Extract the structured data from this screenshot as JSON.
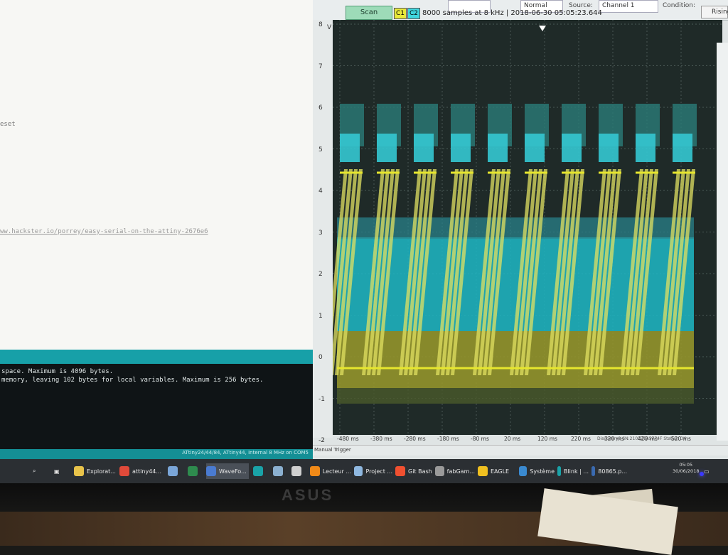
{
  "ide": {
    "code_fragment": "eset",
    "link_fragment": "ww.hackster.io/porrey/easy-serial-on-the-attiny-2676e6",
    "console_lines": [
      " space. Maximum is 4096 bytes.",
      " memory, leaving 102 bytes for local variables. Maximum is 256 bytes."
    ],
    "status": "ATtiny24/44/84, ATtiny44, Internal 8 MHz on COM5"
  },
  "scope": {
    "scan_label": "Scan",
    "ch1": "C1",
    "ch2": "C2",
    "info": "8000 samples at 8 kHz | 2018-06-30 05:05:23.644",
    "mode_value": "Normal",
    "source_label": "Source:",
    "source_value": "Channel 1",
    "condition_label": "Condition:",
    "condition_value": "Rising",
    "y_unit": "V",
    "y_ticks": [
      "8",
      "7",
      "6",
      "5",
      "4",
      "3",
      "2",
      "1",
      "0",
      "-1",
      "-2"
    ],
    "x_ticks": [
      "-480 ms",
      "-380 ms",
      "-280 ms",
      "-180 ms",
      "-80 ms",
      "20 ms",
      "120 ms",
      "220 ms",
      "320 ms",
      "420 ms",
      "520 ms"
    ],
    "manual_trigger": "Manual Trigger",
    "device_status": "Discovery2 SN:210321A5774F   Status: OK",
    "colors": {
      "ch1": "#e6e62e",
      "ch2": "#2fd8e0",
      "background": "#1f2a28"
    }
  },
  "taskbar": {
    "items": [
      {
        "label": "Explorat...",
        "icon": "folder-icon",
        "color": "#e8c34a"
      },
      {
        "label": "attiny44...",
        "icon": "chrome-icon",
        "color": "#e04a3a"
      },
      {
        "label": "",
        "icon": "app-icon",
        "color": "#7aa6d8"
      },
      {
        "label": "",
        "icon": "excel-icon",
        "color": "#2e8b4e"
      },
      {
        "label": "WaveFo...",
        "icon": "waveforms-icon",
        "color": "#4a7bd0"
      },
      {
        "label": "",
        "icon": "arduino-icon",
        "color": "#1aa3a8"
      },
      {
        "label": "",
        "icon": "network-icon",
        "color": "#8bb0d0"
      },
      {
        "label": "",
        "icon": "notepad-icon",
        "color": "#d0d0d0"
      },
      {
        "label": "Lecteur ...",
        "icon": "vlc-icon",
        "color": "#f08a18"
      },
      {
        "label": "Project ...",
        "icon": "globe-icon",
        "color": "#8fb8e0"
      },
      {
        "label": "Git Bash",
        "icon": "git-icon",
        "color": "#f05030"
      },
      {
        "label": "fabGam...",
        "icon": "terminal-icon",
        "color": "#9a9a9a"
      },
      {
        "label": "EAGLE",
        "icon": "eagle-icon",
        "color": "#f0c020"
      },
      {
        "label": "Système",
        "icon": "system-icon",
        "color": "#3a8ad0"
      },
      {
        "label": "Blink | ...",
        "icon": "arduino-icon",
        "color": "#1aa3a8"
      },
      {
        "label": "80865.p...",
        "icon": "pdf-icon",
        "color": "#3a6ab0"
      }
    ],
    "time": "05:05",
    "date": "30/06/2018"
  },
  "monitor": {
    "brand": "ASUS"
  }
}
